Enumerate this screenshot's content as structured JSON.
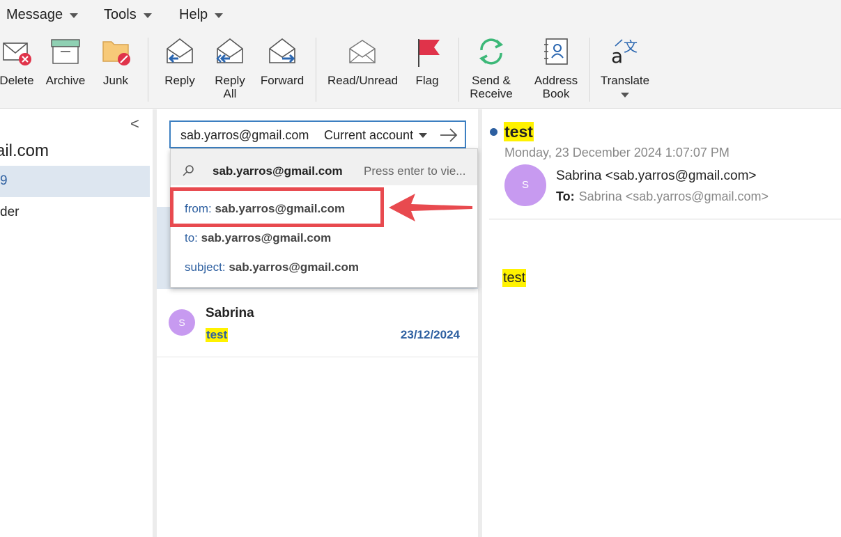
{
  "menu": [
    {
      "label": "Message"
    },
    {
      "label": "Tools"
    },
    {
      "label": "Help"
    }
  ],
  "ribbon": {
    "delete": "Delete",
    "archive": "Archive",
    "junk": "Junk",
    "reply": "Reply",
    "reply_all": "Reply\nAll",
    "forward": "Forward",
    "read_unread": "Read/Unread",
    "flag": "Flag",
    "send_receive": "Send &\nReceive",
    "address_book": "Address\nBook",
    "translate": "Translate"
  },
  "folders": {
    "collapse": "<",
    "account": "ail.com",
    "selected_folder": "9",
    "other_folder": "der"
  },
  "search": {
    "value": "sab.yarros@gmail.com",
    "scope": "Current account"
  },
  "dropdown": {
    "query": "sab.yarros@gmail.com",
    "hint": "Press enter to vie...",
    "items": [
      {
        "prefix": "from:",
        "value": "sab.yarros@gmail.com"
      },
      {
        "prefix": "to:",
        "value": "sab.yarros@gmail.com"
      },
      {
        "prefix": "subject:",
        "value": "sab.yarros@gmail.com"
      }
    ]
  },
  "message_list": [
    {
      "avatar": "S",
      "sender": "Sabrina",
      "subject": "test",
      "date": "23/12/2024"
    }
  ],
  "reading": {
    "subject": "test",
    "date": "Monday, 23 December 2024 1:07:07 PM",
    "avatar": "S",
    "from": "Sabrina <sab.yarros@gmail.com>",
    "to_label": "To:",
    "to": "Sabrina <sab.yarros@gmail.com>",
    "body": "test"
  },
  "colors": {
    "accent": "#2d5fa0",
    "highlight": "#fff200",
    "annotation": "#e84a4f",
    "avatar": "#c79af0"
  }
}
